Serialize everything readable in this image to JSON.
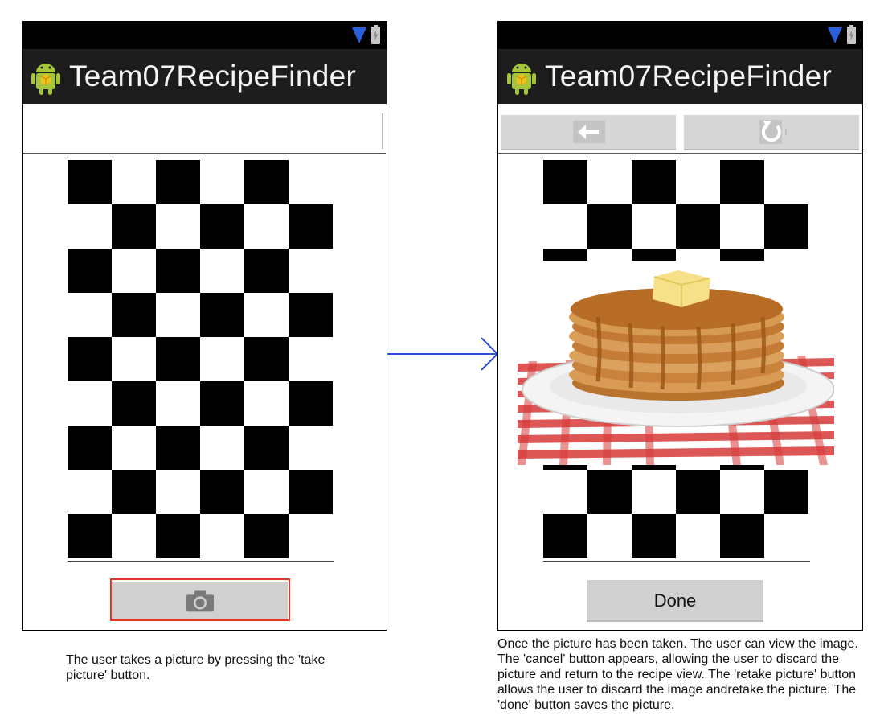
{
  "app_title": "Team07RecipeFinder",
  "left_screen": {
    "take_picture_button": {
      "icon": "camera-icon"
    }
  },
  "right_screen": {
    "cancel_button": {
      "icon": "arrow-left-icon"
    },
    "retake_button": {
      "icon": "retake-icon"
    },
    "done_label": "Done"
  },
  "captions": {
    "left": "The user takes a picture by pressing the 'take picture' button.",
    "right": "Once the picture has been taken. The user can view the image. The 'cancel' button appears, allowing the user to discard the picture and return to the recipe view. The 'retake picture' button allows the user to discard the image andretake the picture. The 'done' button saves the picture."
  },
  "colors": {
    "highlight": "#e8361f",
    "flow_arrow": "#2b4fd6",
    "wifi": "#2b5fd9"
  }
}
